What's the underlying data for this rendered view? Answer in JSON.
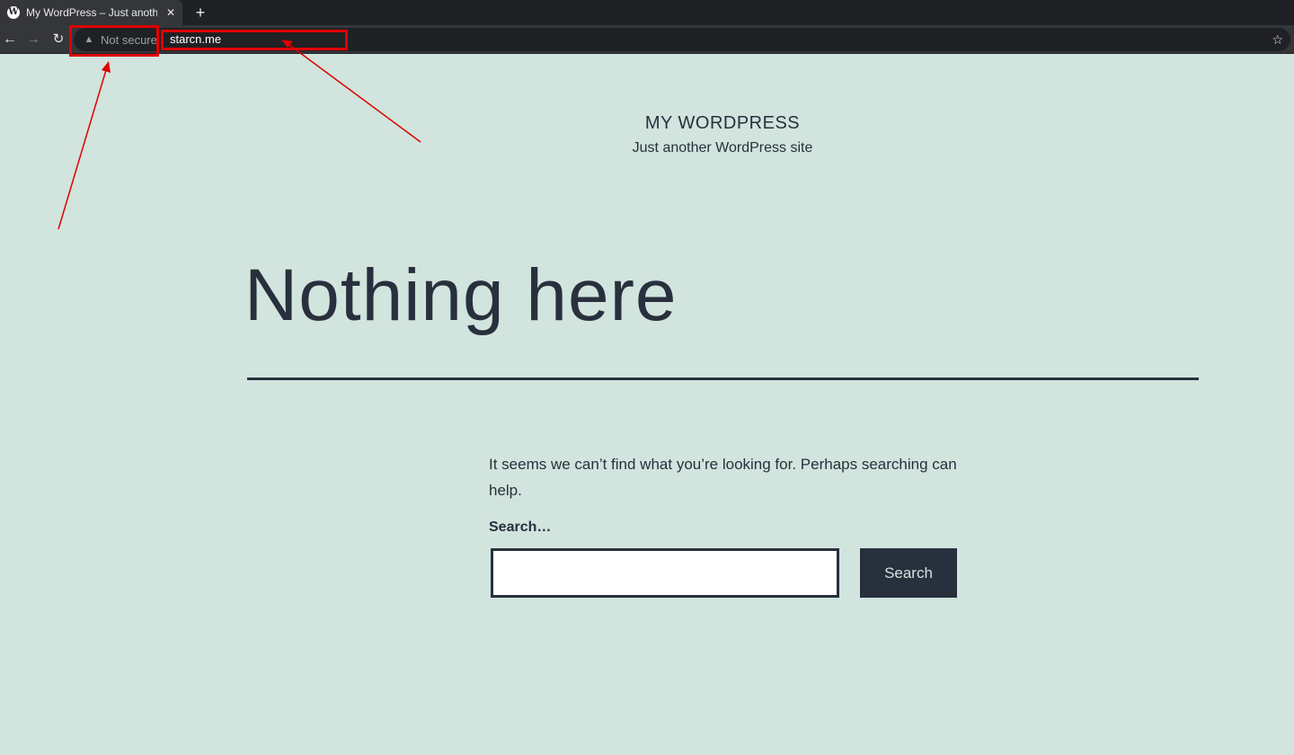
{
  "browser": {
    "tab": {
      "favicon": "wordpress-logo",
      "title": "My WordPress – Just another W",
      "close_glyph": "✕"
    },
    "new_tab_glyph": "+",
    "nav": {
      "back_glyph": "←",
      "forward_glyph": "→",
      "reload_glyph": "↻"
    },
    "omnibox": {
      "security_icon": "warning-triangle",
      "security_label": "Not secure",
      "url": "starcn.me",
      "bookmark_glyph": "☆"
    }
  },
  "site": {
    "title": "MY WORDPRESS",
    "description": "Just another WordPress site"
  },
  "main": {
    "heading": "Nothing here",
    "message": "It seems we can’t find what you’re looking for. Perhaps searching can help.",
    "search": {
      "label": "Search…",
      "value": "",
      "button_label": "Search"
    }
  },
  "colors": {
    "page_background": "#d1e4dd",
    "text": "#28303d",
    "annotation": "#e00000",
    "chrome_dark": "#202124",
    "chrome_toolbar": "#35363a"
  }
}
